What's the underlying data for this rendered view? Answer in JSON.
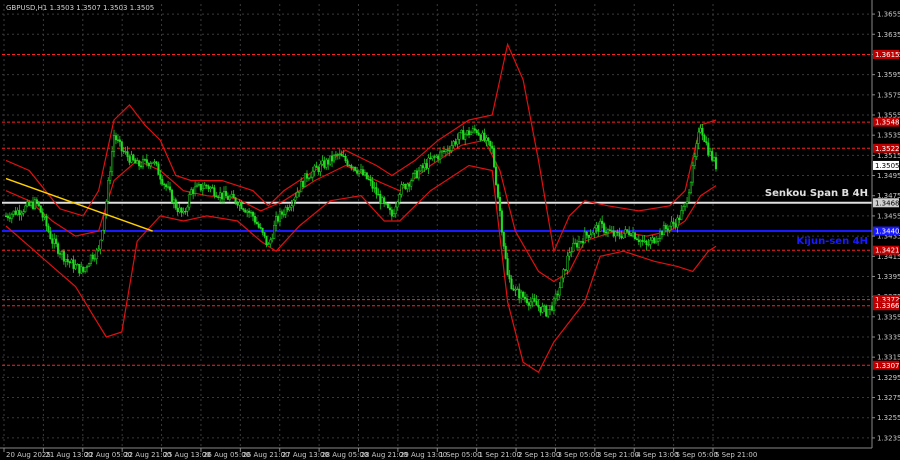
{
  "chart_data": {
    "type": "candlestick",
    "symbol": "GBPUSD,H1",
    "ohlc": "1.3503 1.3507 1.3503 1.3505",
    "ylim": [
      1.3225,
      1.3665
    ],
    "y_ticks": [
      "1.3655",
      "1.3635",
      "1.3615",
      "1.3595",
      "1.3575",
      "1.3555",
      "1.3535",
      "1.3515",
      "1.3495",
      "1.3475",
      "1.3455",
      "1.3435",
      "1.3415",
      "1.3395",
      "1.3375",
      "1.3355",
      "1.3335",
      "1.3315",
      "1.3295",
      "1.3275",
      "1.3255",
      "1.3235"
    ],
    "x_ticks": [
      "20 Aug 2025",
      "21 Aug 13:00",
      "22 Aug 05:00",
      "22 Aug 21:00",
      "25 Aug 13:00",
      "26 Aug 05:00",
      "26 Aug 21:00",
      "27 Aug 13:00",
      "28 Aug 05:00",
      "28 Aug 21:00",
      "29 Aug 13:00",
      "1 Sep 05:00",
      "1 Sep 21:00",
      "2 Sep 13:00",
      "3 Sep 05:00",
      "3 Sep 21:00",
      "4 Sep 13:00",
      "5 Sep 05:00",
      "5 Sep 21:00"
    ],
    "horizontal_levels": [
      {
        "price": 1.3615,
        "label": "1.3615",
        "color": "#ff2020",
        "style": "dotted"
      },
      {
        "price": 1.3548,
        "label": "1.3548",
        "color": "#ff2020",
        "style": "dotted"
      },
      {
        "price": 1.3522,
        "label": "1.3522",
        "color": "#ff2020",
        "style": "dotted"
      },
      {
        "price": 1.3421,
        "label": "1.3421",
        "color": "#ff2020",
        "style": "dotted"
      },
      {
        "price": 1.3372,
        "label": "1.3372",
        "color": "#ff2020",
        "style": "dotted"
      },
      {
        "price": 1.3366,
        "label": "1.3366",
        "color": "#ff2020",
        "style": "dotted"
      },
      {
        "price": 1.3307,
        "label": "1.3307",
        "color": "#ff2020",
        "style": "dotted"
      }
    ],
    "senkou_span_b": {
      "label": "Senkou Span B 4H",
      "price": 1.3468,
      "price_label": "1.3468",
      "color": "#e0e0e0"
    },
    "kijun_sen": {
      "label": "Kijun-sen 4H",
      "price": 1.344,
      "price_label": "1.3440",
      "color": "#1a1aff"
    },
    "current_price": {
      "price": 1.3505,
      "label": "1.3505"
    },
    "trendline": {
      "color": "#ffd000",
      "from": {
        "bar": 0,
        "price": 1.3492
      },
      "to": {
        "bar": 19,
        "price": 1.344
      }
    },
    "close_path": [
      [
        0,
        1.3455
      ],
      [
        4,
        1.3468
      ],
      [
        5,
        1.345
      ],
      [
        6,
        1.343
      ],
      [
        8,
        1.341
      ],
      [
        10,
        1.34
      ],
      [
        11,
        1.3415
      ],
      [
        12,
        1.342
      ],
      [
        13,
        1.347
      ],
      [
        14,
        1.3535
      ],
      [
        15,
        1.352
      ],
      [
        17,
        1.3505
      ],
      [
        19,
        1.351
      ],
      [
        20,
        1.3495
      ],
      [
        22,
        1.3465
      ],
      [
        23,
        1.3455
      ],
      [
        24,
        1.348
      ],
      [
        26,
        1.3485
      ],
      [
        28,
        1.3475
      ],
      [
        30,
        1.347
      ],
      [
        32,
        1.3455
      ],
      [
        34,
        1.3425
      ],
      [
        35,
        1.345
      ],
      [
        37,
        1.347
      ],
      [
        39,
        1.3495
      ],
      [
        41,
        1.3505
      ],
      [
        43,
        1.3515
      ],
      [
        45,
        1.3505
      ],
      [
        47,
        1.349
      ],
      [
        49,
        1.3465
      ],
      [
        50,
        1.3455
      ],
      [
        51,
        1.348
      ],
      [
        53,
        1.3495
      ],
      [
        55,
        1.351
      ],
      [
        57,
        1.352
      ],
      [
        59,
        1.3535
      ],
      [
        61,
        1.354
      ],
      [
        62,
        1.353
      ],
      [
        63,
        1.352
      ],
      [
        64,
        1.346
      ],
      [
        65,
        1.3395
      ],
      [
        66,
        1.338
      ],
      [
        68,
        1.337
      ],
      [
        70,
        1.336
      ],
      [
        71,
        1.3368
      ],
      [
        72,
        1.339
      ],
      [
        73,
        1.342
      ],
      [
        75,
        1.3435
      ],
      [
        77,
        1.3445
      ],
      [
        79,
        1.3435
      ],
      [
        81,
        1.344
      ],
      [
        83,
        1.3425
      ],
      [
        85,
        1.344
      ],
      [
        87,
        1.345
      ],
      [
        88,
        1.3465
      ],
      [
        89,
        1.35
      ],
      [
        90,
        1.3545
      ],
      [
        91,
        1.352
      ],
      [
        92,
        1.3505
      ]
    ],
    "bb_upper": [
      [
        0,
        1.351
      ],
      [
        3,
        1.35
      ],
      [
        7,
        1.3462
      ],
      [
        10,
        1.3455
      ],
      [
        12,
        1.348
      ],
      [
        14,
        1.355
      ],
      [
        16,
        1.3565
      ],
      [
        18,
        1.3545
      ],
      [
        20,
        1.353
      ],
      [
        22,
        1.3495
      ],
      [
        24,
        1.349
      ],
      [
        28,
        1.349
      ],
      [
        32,
        1.348
      ],
      [
        34,
        1.3465
      ],
      [
        36,
        1.348
      ],
      [
        40,
        1.35
      ],
      [
        44,
        1.352
      ],
      [
        48,
        1.3505
      ],
      [
        50,
        1.3495
      ],
      [
        53,
        1.351
      ],
      [
        56,
        1.353
      ],
      [
        60,
        1.355
      ],
      [
        63,
        1.3555
      ],
      [
        65,
        1.3625
      ],
      [
        67,
        1.359
      ],
      [
        69,
        1.351
      ],
      [
        71,
        1.342
      ],
      [
        73,
        1.3455
      ],
      [
        75,
        1.347
      ],
      [
        78,
        1.3465
      ],
      [
        82,
        1.346
      ],
      [
        86,
        1.3465
      ],
      [
        88,
        1.348
      ],
      [
        90,
        1.3545
      ],
      [
        92,
        1.355
      ]
    ],
    "bb_middle": [
      [
        0,
        1.348
      ],
      [
        3,
        1.347
      ],
      [
        6,
        1.345
      ],
      [
        9,
        1.3435
      ],
      [
        12,
        1.344
      ],
      [
        14,
        1.349
      ],
      [
        17,
        1.351
      ],
      [
        20,
        1.35
      ],
      [
        23,
        1.348
      ],
      [
        26,
        1.3475
      ],
      [
        30,
        1.3472
      ],
      [
        33,
        1.346
      ],
      [
        36,
        1.347
      ],
      [
        40,
        1.349
      ],
      [
        44,
        1.3505
      ],
      [
        48,
        1.349
      ],
      [
        51,
        1.348
      ],
      [
        55,
        1.3505
      ],
      [
        59,
        1.3525
      ],
      [
        62,
        1.353
      ],
      [
        64,
        1.35
      ],
      [
        66,
        1.344
      ],
      [
        69,
        1.34
      ],
      [
        71,
        1.339
      ],
      [
        73,
        1.34
      ],
      [
        75,
        1.343
      ],
      [
        79,
        1.344
      ],
      [
        83,
        1.3435
      ],
      [
        86,
        1.344
      ],
      [
        88,
        1.345
      ],
      [
        90,
        1.3475
      ],
      [
        92,
        1.3485
      ]
    ],
    "bb_lower": [
      [
        0,
        1.3445
      ],
      [
        3,
        1.3425
      ],
      [
        6,
        1.3405
      ],
      [
        9,
        1.3385
      ],
      [
        11,
        1.336
      ],
      [
        13,
        1.3335
      ],
      [
        15,
        1.334
      ],
      [
        17,
        1.343
      ],
      [
        20,
        1.3455
      ],
      [
        23,
        1.345
      ],
      [
        26,
        1.3455
      ],
      [
        30,
        1.345
      ],
      [
        33,
        1.343
      ],
      [
        35,
        1.342
      ],
      [
        38,
        1.3445
      ],
      [
        42,
        1.347
      ],
      [
        46,
        1.3475
      ],
      [
        49,
        1.345
      ],
      [
        51,
        1.345
      ],
      [
        55,
        1.348
      ],
      [
        60,
        1.3505
      ],
      [
        63,
        1.35
      ],
      [
        65,
        1.337
      ],
      [
        67,
        1.331
      ],
      [
        69,
        1.33
      ],
      [
        71,
        1.333
      ],
      [
        73,
        1.335
      ],
      [
        75,
        1.337
      ],
      [
        77,
        1.3415
      ],
      [
        80,
        1.342
      ],
      [
        84,
        1.341
      ],
      [
        87,
        1.3405
      ],
      [
        89,
        1.34
      ],
      [
        91,
        1.342
      ],
      [
        92,
        1.3425
      ]
    ]
  }
}
